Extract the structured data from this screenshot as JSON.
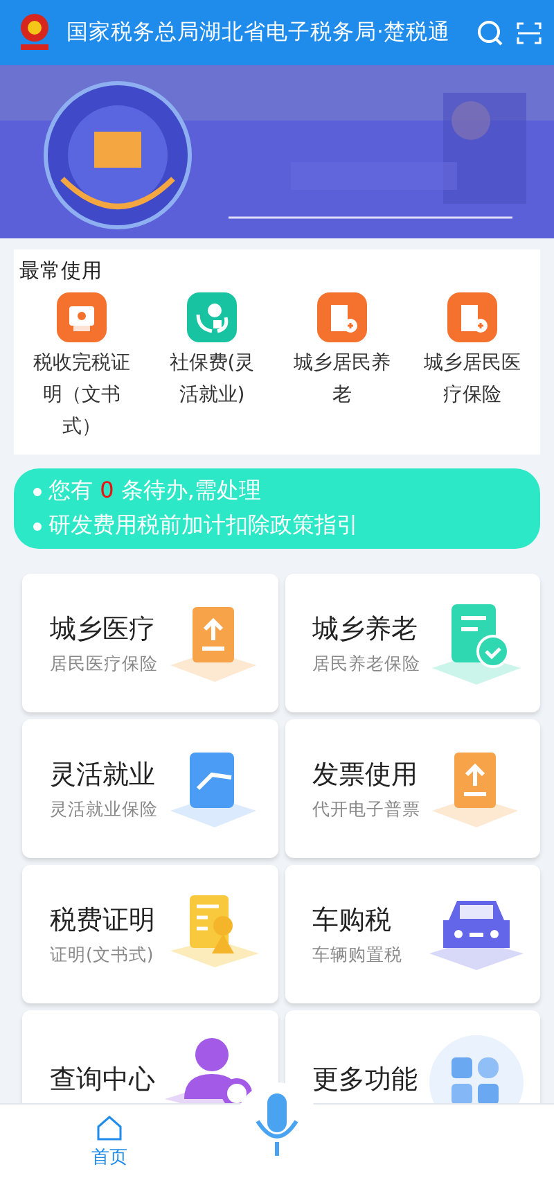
{
  "header": {
    "title": "国家税务总局湖北省电子税务局·楚税通"
  },
  "frequent": {
    "title": "最常使用",
    "items": [
      {
        "label": "税收完税证明（文书式）",
        "kind": "certificate",
        "color": "#f4712e"
      },
      {
        "label": "社保费(灵活就业)",
        "kind": "social",
        "color": "#17c3a0"
      },
      {
        "label": "城乡居民养老",
        "kind": "building",
        "color": "#f4712e"
      },
      {
        "label": "城乡居民医疗保险",
        "kind": "building",
        "color": "#f4712e"
      }
    ]
  },
  "notices": [
    {
      "kind": "todo",
      "prefix": "您有",
      "count": "0",
      "suffix": "条待办,需处理"
    },
    {
      "kind": "text",
      "text": "研发费用税前加计扣除政策指引"
    }
  ],
  "services": [
    {
      "title": "城乡医疗",
      "subtitle": "居民医疗保险",
      "kind": "upload",
      "color": "#f6a34a"
    },
    {
      "title": "城乡养老",
      "subtitle": "居民养老保险",
      "kind": "check",
      "color": "#2fd8b0"
    },
    {
      "title": "灵活就业",
      "subtitle": "灵活就业保险",
      "kind": "folder",
      "color": "#4a9cf5"
    },
    {
      "title": "发票使用",
      "subtitle": "代开电子普票",
      "kind": "upload",
      "color": "#f6a34a"
    },
    {
      "title": "税费证明",
      "subtitle": "证明(文书式)",
      "kind": "certificate",
      "color": "#f8c93c"
    },
    {
      "title": "车购税",
      "subtitle": "车辆购置税",
      "kind": "car",
      "color": "#6366e8"
    },
    {
      "title": "查询中心",
      "kind": "person",
      "color": "#a35ae6"
    },
    {
      "title": "更多功能",
      "kind": "grid",
      "color": "#6aa8f2"
    }
  ],
  "tabbar": {
    "items": [
      {
        "label": "首页",
        "selected": true
      }
    ]
  }
}
